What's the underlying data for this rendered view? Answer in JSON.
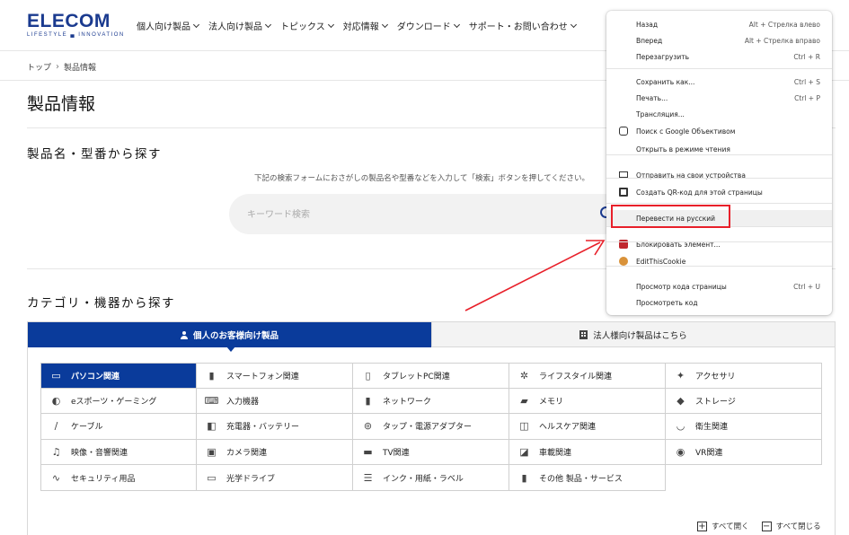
{
  "header": {
    "logo": "ELECOM",
    "logo_tagline": "LIFESTYLE ▄ INNOVATION",
    "nav": [
      "個人向け製品",
      "法人向け製品",
      "トピックス",
      "対応情報",
      "ダウンロード",
      "サポート・お問い合わせ"
    ]
  },
  "breadcrumb": {
    "home": "トップ",
    "current": "製品情報"
  },
  "page": {
    "title": "製品情報"
  },
  "search_section": {
    "title": "製品名・型番から探す",
    "hint": "下記の検索フォームにおさがしの製品名や型番などを入力して「検索」ボタンを押してください。",
    "placeholder": "キーワード検索"
  },
  "category_section": {
    "title": "カテゴリ・機器から探す",
    "tab_personal": "個人のお客様向け製品",
    "tab_business": "法人様向け製品はこちら",
    "categories": [
      {
        "label": "パソコン関連",
        "icon": "laptop-icon"
      },
      {
        "label": "スマートフォン関連",
        "icon": "smartphone-icon"
      },
      {
        "label": "タブレットPC関連",
        "icon": "tablet-icon"
      },
      {
        "label": "ライフスタイル関連",
        "icon": "lifestyle-icon"
      },
      {
        "label": "アクセサリ",
        "icon": "accessory-icon"
      },
      {
        "label": "eスポーツ・ゲーミング",
        "icon": "gaming-mouse-icon"
      },
      {
        "label": "入力機器",
        "icon": "keyboard-icon"
      },
      {
        "label": "ネットワーク",
        "icon": "router-icon"
      },
      {
        "label": "メモリ",
        "icon": "usb-memory-icon"
      },
      {
        "label": "ストレージ",
        "icon": "hdd-icon"
      },
      {
        "label": "ケーブル",
        "icon": "cable-icon"
      },
      {
        "label": "充電器・バッテリー",
        "icon": "charger-icon"
      },
      {
        "label": "タップ・電源アダプター",
        "icon": "power-tap-icon"
      },
      {
        "label": "ヘルスケア関連",
        "icon": "scale-icon"
      },
      {
        "label": "衛生関連",
        "icon": "mask-icon"
      },
      {
        "label": "映像・音響関連",
        "icon": "earphones-icon"
      },
      {
        "label": "カメラ関連",
        "icon": "camera-icon"
      },
      {
        "label": "TV関連",
        "icon": "tv-icon"
      },
      {
        "label": "車載関連",
        "icon": "car-charger-icon"
      },
      {
        "label": "VR関連",
        "icon": "vr-headset-icon"
      },
      {
        "label": "セキュリティ用品",
        "icon": "security-cable-icon"
      },
      {
        "label": "光学ドライブ",
        "icon": "optical-drive-icon"
      },
      {
        "label": "インク・用紙・ラベル",
        "icon": "paper-icon"
      },
      {
        "label": "その他 製品・サービス",
        "icon": "other-icon"
      }
    ],
    "expand_all": "すべて開く",
    "collapse_all": "すべて閉じる"
  },
  "context_menu": {
    "items": [
      {
        "label": "Назад",
        "shortcut": "Alt + Стрелка влево"
      },
      {
        "label": "Вперед",
        "shortcut": "Alt + Стрелка вправо"
      },
      {
        "label": "Перезагрузить",
        "shortcut": "Ctrl + R"
      },
      {
        "label": "Сохранить как...",
        "shortcut": "Ctrl + S"
      },
      {
        "label": "Печать...",
        "shortcut": "Ctrl + P"
      },
      {
        "label": "Трансляция...",
        "shortcut": ""
      },
      {
        "label": "Поиск с Google Объективом",
        "shortcut": ""
      },
      {
        "label": "Открыть в режиме чтения",
        "shortcut": ""
      },
      {
        "label": "Отправить на свои устройства",
        "shortcut": ""
      },
      {
        "label": "Создать QR-код для этой страницы",
        "shortcut": ""
      },
      {
        "label": "Перевести на русский",
        "shortcut": ""
      },
      {
        "label": "Блокировать элемент...",
        "shortcut": ""
      },
      {
        "label": "EditThisCookie",
        "shortcut": ""
      },
      {
        "label": "Просмотр кода страницы",
        "shortcut": "Ctrl + U"
      },
      {
        "label": "Просмотреть код",
        "shortcut": ""
      }
    ]
  },
  "colors": {
    "brand": "#1a3a8f",
    "active_tab": "#0a3b9b",
    "highlight": "#e8202a"
  }
}
